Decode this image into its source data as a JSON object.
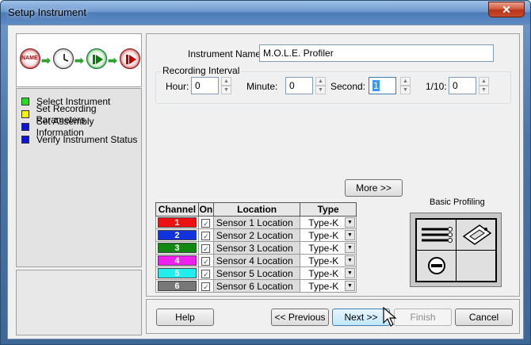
{
  "window": {
    "title": "Setup Instrument",
    "close_glyph": "✕"
  },
  "flow_icons": {
    "name_label": "NAME",
    "arrow": "➡"
  },
  "steps": [
    {
      "label": "Select Instrument",
      "color": "#22dd22"
    },
    {
      "label": "Set Recording Parameters",
      "color": "#f4f400"
    },
    {
      "label": "Set Assembly Information",
      "color": "#1010dd"
    },
    {
      "label": "Verify Instrument Status",
      "color": "#1010dd"
    }
  ],
  "form": {
    "instrument_name_label": "Instrument Name:",
    "instrument_name_value": "M.O.L.E. Profiler",
    "recording_interval_label": "Recording Interval",
    "hour_label": "Hour:",
    "hour_value": "0",
    "minute_label": "Minute:",
    "minute_value": "0",
    "second_label": "Second:",
    "second_value": "1",
    "tenth_label": "1/10:",
    "tenth_value": "0",
    "spin_up": "▲",
    "spin_down": "▼"
  },
  "more_button": "More >>",
  "channel_table": {
    "headers": {
      "channel": "Channel",
      "on": "On",
      "location": "Location",
      "type": "Type"
    },
    "checkmark": "✓",
    "dropdown_glyph": "▼",
    "rows": [
      {
        "channel": "1",
        "color": "#ee1111",
        "location": "Sensor 1 Location",
        "type": "Type-K"
      },
      {
        "channel": "2",
        "color": "#1133dd",
        "location": "Sensor 2 Location",
        "type": "Type-K"
      },
      {
        "channel": "3",
        "color": "#118811",
        "location": "Sensor 3 Location",
        "type": "Type-K"
      },
      {
        "channel": "4",
        "color": "#ee22ee",
        "location": "Sensor 4 Location",
        "type": "Type-K"
      },
      {
        "channel": "5",
        "color": "#22eeee",
        "location": "Sensor 5 Location",
        "type": "Type-K"
      },
      {
        "channel": "6",
        "color": "#777777",
        "location": "Sensor 6 Location",
        "type": "Type-K"
      }
    ]
  },
  "profiling": {
    "label": "Basic Profiling"
  },
  "buttons": {
    "help": "Help",
    "previous": "<< Previous",
    "next": "Next >>",
    "finish": "Finish",
    "cancel": "Cancel"
  }
}
